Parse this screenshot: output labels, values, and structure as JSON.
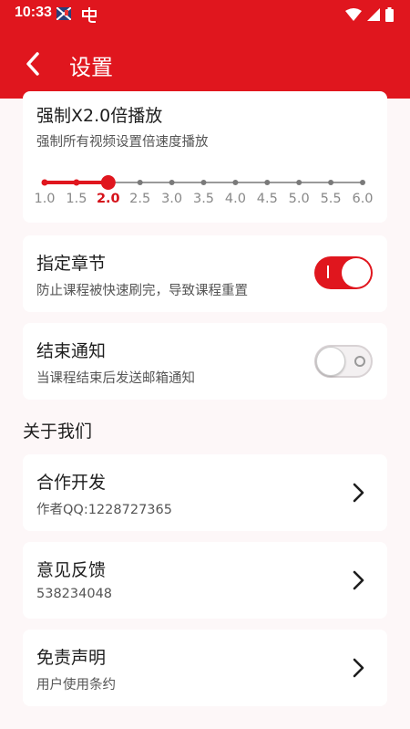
{
  "status_bar": {
    "time": "10:33",
    "icon_a": "flag-icon",
    "icon_b": "app-icon"
  },
  "app_bar": {
    "title": "设置"
  },
  "speed_card": {
    "title": "强制X2.0倍播放",
    "subtitle": "强制所有视频设置倍速度播放",
    "ticks": [
      "1.0",
      "1.5",
      "2.0",
      "2.5",
      "3.0",
      "3.5",
      "4.0",
      "4.5",
      "5.0",
      "5.5",
      "6.0"
    ],
    "selected": 2.0
  },
  "chapter_card": {
    "title": "指定章节",
    "subtitle": "防止课程被快速刷完，导致课程重置",
    "enabled": true
  },
  "notify_card": {
    "title": "结束通知",
    "subtitle": "当课程结束后发送邮箱通知",
    "enabled": false
  },
  "about": {
    "header": "关于我们",
    "items": [
      {
        "title": "合作开发",
        "subtitle": "作者QQ:1228727365"
      },
      {
        "title": "意见反馈",
        "subtitle": "538234048"
      },
      {
        "title": "免责声明",
        "subtitle": "用户使用条约"
      }
    ]
  },
  "colors": {
    "accent": "#e0161e",
    "background": "#fdf7f8"
  }
}
